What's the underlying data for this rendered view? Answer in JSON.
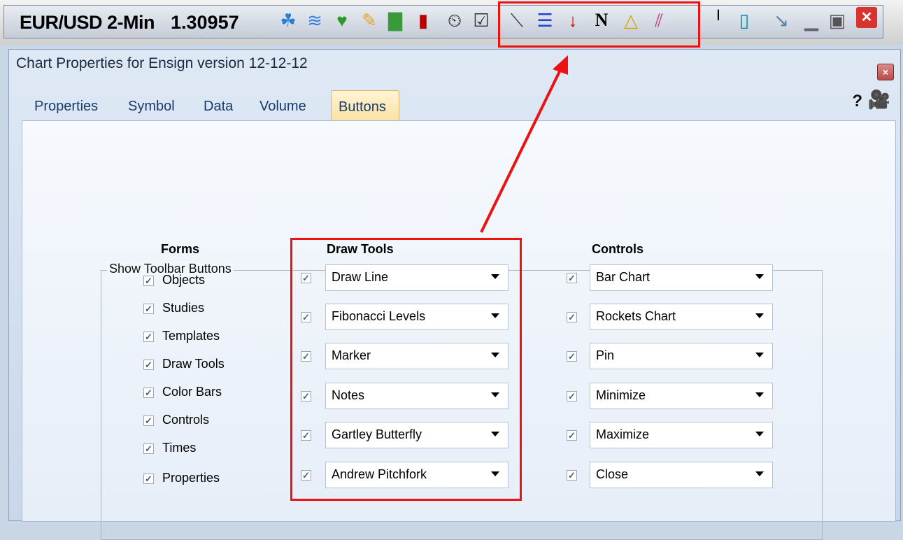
{
  "toolbar": {
    "ticker": "EUR/USD 2-Min",
    "price": "1.30957",
    "icons": [
      "object-icon",
      "studies-icon",
      "templates-icon",
      "draw-tools-icon",
      "color-bars-icon",
      "candle-icon",
      "clock-icon",
      "properties-icon",
      "draw-line-icon",
      "fibonacci-icon",
      "marker-icon",
      "notes-icon",
      "gartley-icon",
      "pitchfork-icon",
      "bar-chart-icon",
      "rockets-chart-icon",
      "pin-icon",
      "minimize-icon",
      "maximize-icon",
      "close-icon"
    ],
    "notes_glyph": "N",
    "accent": "#e11111"
  },
  "dialog": {
    "title": "Chart Properties for Ensign version 12-12-12",
    "close_glyph": "×",
    "help_glyph": "?",
    "tabs": [
      "Properties",
      "Symbol",
      "Data",
      "Volume",
      "Buttons"
    ],
    "active_tab": "Buttons"
  },
  "group": {
    "title": "Show Toolbar Buttons",
    "forms": {
      "heading": "Forms",
      "items": [
        "Objects",
        "Studies",
        "Templates",
        "Draw Tools",
        "Color Bars",
        "Controls",
        "Times",
        "Properties"
      ]
    },
    "draw_tools": {
      "heading": "Draw Tools",
      "items": [
        "Draw Line",
        "Fibonacci Levels",
        "Marker",
        "Notes",
        "Gartley Butterfly",
        "Andrew Pitchfork"
      ]
    },
    "controls": {
      "heading": "Controls",
      "items": [
        "Bar Chart",
        "Rockets Chart",
        "Pin",
        "Minimize",
        "Maximize",
        "Close"
      ]
    },
    "check_glyph": "✓"
  }
}
